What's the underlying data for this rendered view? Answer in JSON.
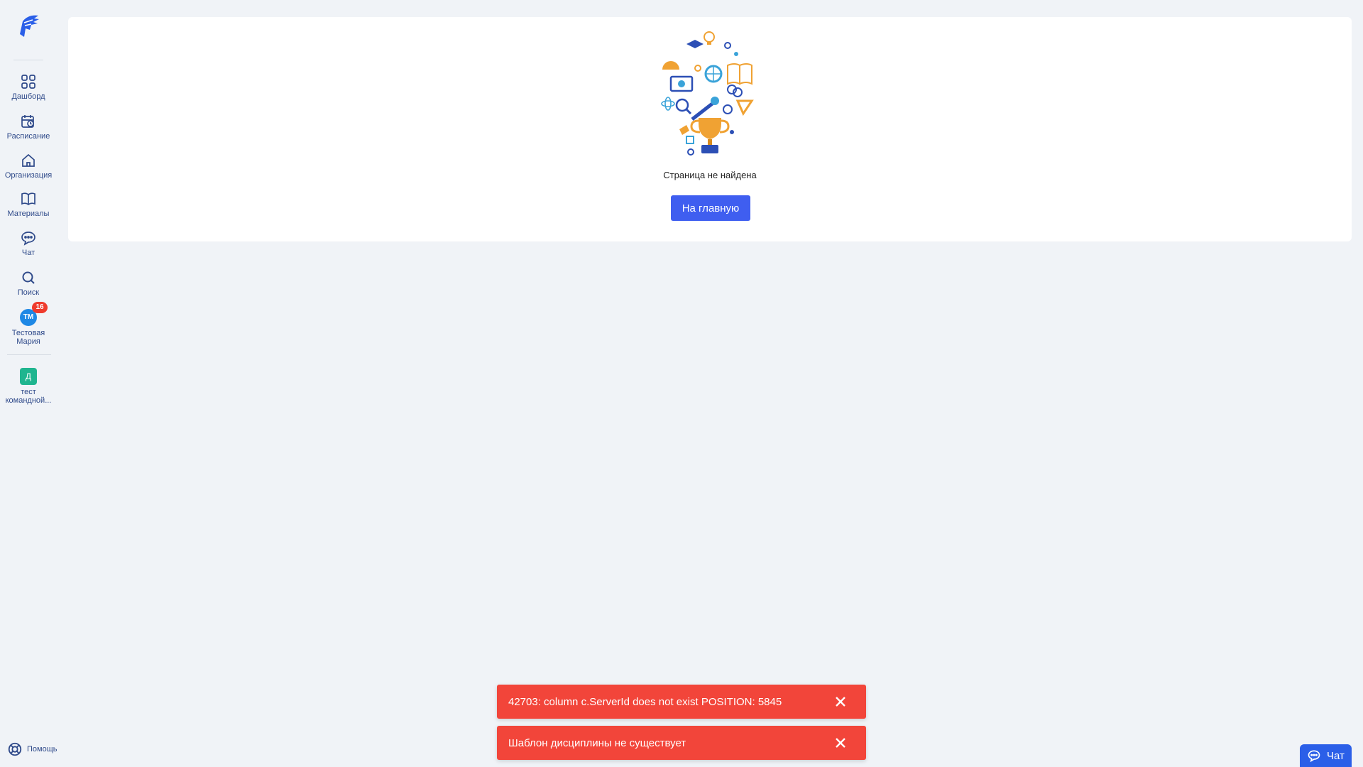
{
  "sidebar": {
    "logo_icon": "spartan-helmet-logo",
    "items": [
      {
        "label": "Дашборд",
        "icon": "dashboard-grid-icon"
      },
      {
        "label": "Расписание",
        "icon": "calendar-clock-icon"
      },
      {
        "label": "Организация",
        "icon": "home-icon"
      },
      {
        "label": "Материалы",
        "icon": "book-icon"
      },
      {
        "label": "Чат",
        "icon": "chat-bubble-icon"
      },
      {
        "label": "Поиск",
        "icon": "search-icon"
      }
    ],
    "user": {
      "initials": "ТМ",
      "badge": "16",
      "name": "Тестовая Мария"
    },
    "team": {
      "initial": "Д",
      "name": "тест командной..."
    },
    "help_label": "Помощь"
  },
  "main": {
    "not_found_text": "Страница не найдена",
    "home_button": "На главную"
  },
  "toasts": [
    {
      "message": "42703: column c.ServerId does not exist POSITION: 5845"
    },
    {
      "message": "Шаблон дисциплины не существует"
    }
  ],
  "chat_widget": {
    "label": "Чат"
  },
  "colors": {
    "accent": "#3f5ef0",
    "toast_error": "#f2453a",
    "background": "#f0f3f7",
    "sidebar_text": "#2f4a8a"
  }
}
